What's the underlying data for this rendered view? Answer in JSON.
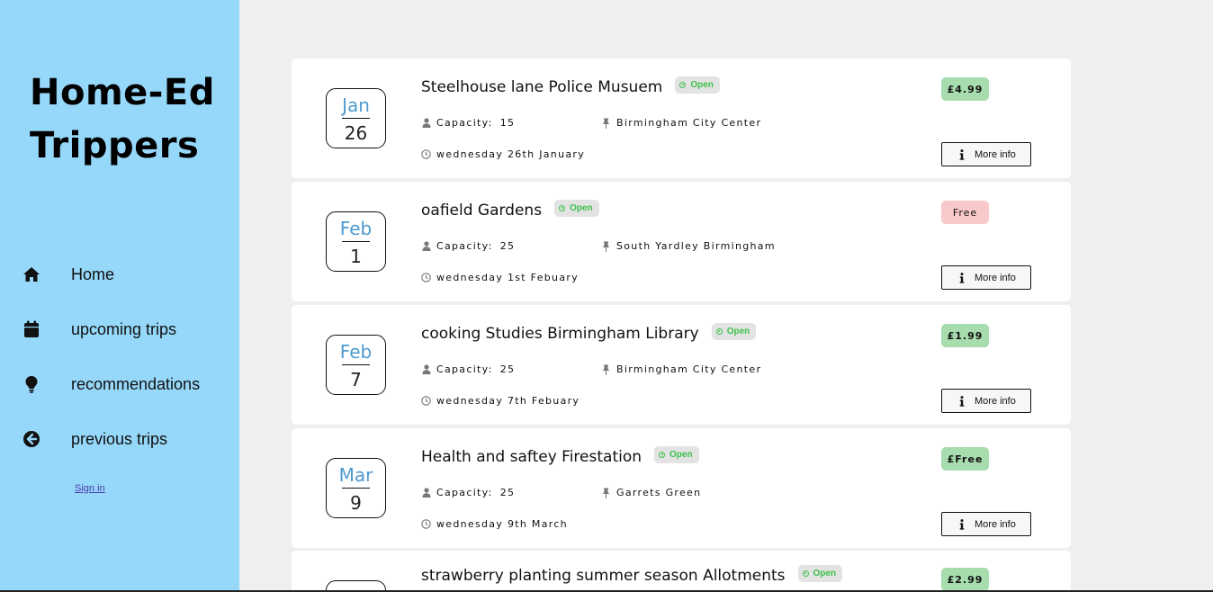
{
  "sidebar": {
    "brand_line1": "Home-Ed",
    "brand_line2": "Trippers",
    "nav": [
      {
        "label": "Home",
        "icon": "home-icon"
      },
      {
        "label": "upcoming trips",
        "icon": "calendar-icon"
      },
      {
        "label": "recommendations",
        "icon": "lightbulb-icon"
      },
      {
        "label": "previous trips",
        "icon": "arrow-left-circle-icon"
      }
    ],
    "signin": "Sign in"
  },
  "trips": [
    {
      "month": "Jan",
      "day": "26",
      "title": "Steelhouse lane Police Musuem",
      "status": "Open",
      "capacity_label": "Capacity:",
      "capacity": "15",
      "location": "Birmingham City Center",
      "date": "wednesday 26th January",
      "price": "£4.99",
      "price_kind": "paid",
      "more": "More info"
    },
    {
      "month": "Feb",
      "day": "1",
      "title": "oafield Gardens",
      "status": "Open",
      "capacity_label": "Capacity:",
      "capacity": "25",
      "location": "South Yardley Birmingham",
      "date": "wednesday 1st Febuary",
      "price": "Free",
      "price_kind": "free",
      "more": "More info"
    },
    {
      "month": "Feb",
      "day": "7",
      "title": "cooking Studies Birmingham Library",
      "status": "Open",
      "capacity_label": "Capacity:",
      "capacity": "25",
      "location": "Birmingham City Center",
      "date": "wednesday 7th Febuary",
      "price": "£1.99",
      "price_kind": "paid",
      "more": "More info"
    },
    {
      "month": "Mar",
      "day": "9",
      "title": "Health and saftey Firestation",
      "status": "Open",
      "capacity_label": "Capacity:",
      "capacity": "25",
      "location": "Garrets Green",
      "date": "wednesday 9th March",
      "price": "£Free",
      "price_kind": "paid",
      "more": "More info"
    },
    {
      "month": "",
      "day": "",
      "title": "strawberry planting summer season Allotments",
      "status": "Open",
      "capacity_label": "",
      "capacity": "",
      "location": "",
      "date": "",
      "price": "£2.99",
      "price_kind": "paid",
      "more": ""
    }
  ],
  "colors": {
    "sidebar_bg": "#96d8fa",
    "page_bg": "#f0eeef",
    "month_text": "#4d9ad0",
    "status_green": "#3cc14a",
    "price_paid_bg": "#a7dcae",
    "price_free_bg": "#f9c9c9"
  }
}
